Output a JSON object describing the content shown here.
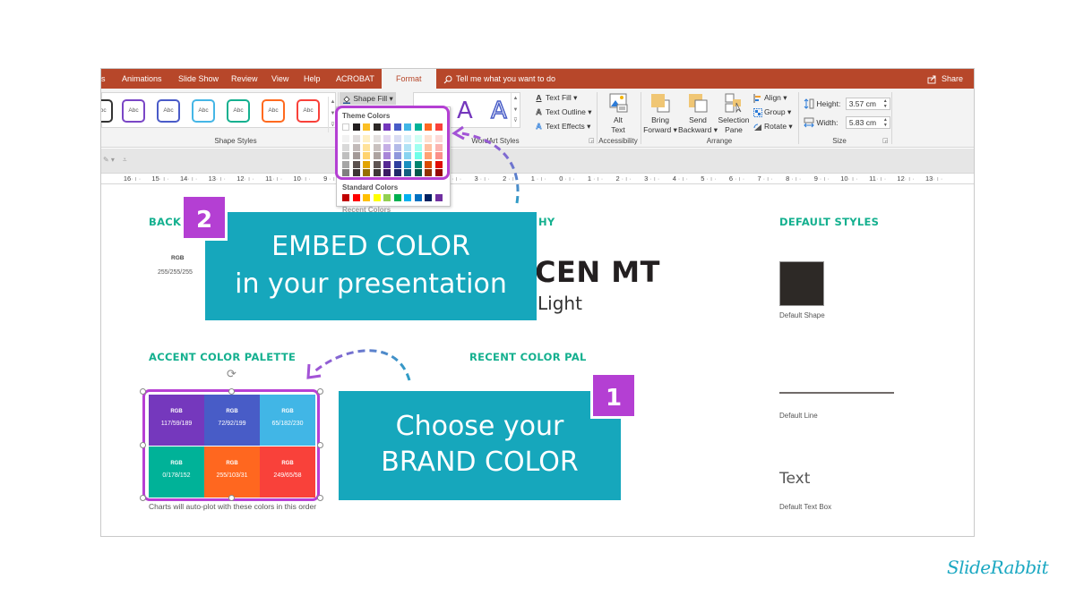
{
  "ribbon_tabs": [
    {
      "label": "s"
    },
    {
      "label": "Animations"
    },
    {
      "label": "Slide Show"
    },
    {
      "label": "Review"
    },
    {
      "label": "View"
    },
    {
      "label": "Help"
    },
    {
      "label": "ACROBAT"
    },
    {
      "label": "Format",
      "active": true
    }
  ],
  "tell_me": "Tell me what you want to do",
  "share_label": "Share",
  "shape_styles": {
    "items": [
      {
        "label": "Abc",
        "color": "#333333"
      },
      {
        "label": "Abc",
        "color": "#7a46c6"
      },
      {
        "label": "Abc",
        "color": "#4a5bc8"
      },
      {
        "label": "Abc",
        "color": "#45b6e6"
      },
      {
        "label": "Abc",
        "color": "#14b08f"
      },
      {
        "label": "Abc",
        "color": "#ff6a1f"
      },
      {
        "label": "Abc",
        "color": "#f9413a"
      }
    ],
    "group_label": "Shape Styles"
  },
  "shape_fill": {
    "label": "Shape Fill",
    "theme_colors_label": "Theme Colors",
    "standard_colors_label": "Standard Colors",
    "recent_colors_label": "Recent Colors",
    "theme_colors": [
      "#ffffff",
      "#231f20",
      "#fbbf24",
      "#2d2926",
      "#7538bd",
      "#485cc7",
      "#41b6e6",
      "#00b298",
      "#ff671f",
      "#f9413a"
    ],
    "tints": [
      [
        "#f2f2f2",
        "#e0dcdc",
        "#fff0c4",
        "#e4e0df",
        "#e3d6f2",
        "#d9dcf3",
        "#d8f0fa",
        "#cffff4",
        "#ffe0d0",
        "#fdd9d7"
      ],
      [
        "#d9d9d9",
        "#c2bab9",
        "#ffe29a",
        "#c9c1bf",
        "#c5aee5",
        "#b3bae8",
        "#b0e2f5",
        "#9ffff0",
        "#ffc1a2",
        "#fcb4b0"
      ],
      [
        "#bfbfbf",
        "#a39997",
        "#ffd36e",
        "#ada3a0",
        "#a885d8",
        "#8e97dc",
        "#88d3f0",
        "#6ffee8",
        "#ffa274",
        "#fb8f89"
      ],
      [
        "#a6a6a6",
        "#5a504e",
        "#e2a400",
        "#5e5452",
        "#562893",
        "#2f3f9f",
        "#198fbf",
        "#00856f",
        "#d94b00",
        "#e00c04"
      ],
      [
        "#808080",
        "#3c3534",
        "#967000",
        "#3f3836",
        "#3a1b62",
        "#1f2a6a",
        "#116080",
        "#00594a",
        "#913200",
        "#950803"
      ]
    ],
    "standard_colors": [
      "#c00000",
      "#ff0000",
      "#ffc000",
      "#ffff00",
      "#92d050",
      "#00b050",
      "#00b0f0",
      "#0070c0",
      "#002060",
      "#7030a0"
    ]
  },
  "wordart": {
    "group_label": "WordArt Styles",
    "a_glyph": "A"
  },
  "text_commands": [
    {
      "icon": "A",
      "label": "Text Fill ▾"
    },
    {
      "icon": "A",
      "label": "Text Outline ▾"
    },
    {
      "icon": "A",
      "label": "Text Effects ▾"
    }
  ],
  "accessibility": {
    "button_line1": "Alt",
    "button_line2": "Text",
    "group_label": "Accessibility"
  },
  "arrange": {
    "bring_forward": [
      "Bring",
      "Forward ▾"
    ],
    "send_backward": [
      "Send",
      "Backward ▾"
    ],
    "selection_pane": [
      "Selection",
      "Pane"
    ],
    "align": "Align ▾",
    "group": "Group ▾",
    "rotate": "Rotate ▾",
    "group_label": "Arrange"
  },
  "size": {
    "height_label": "Height:",
    "height_value": "3.57 cm",
    "width_label": "Width:",
    "width_value": "5.83 cm",
    "group_label": "Size"
  },
  "ruler_left": [
    "16",
    "15",
    "14",
    "13",
    "12",
    "11",
    "10",
    "9"
  ],
  "ruler_right": [
    "4",
    "3",
    "2",
    "1",
    "0",
    "1",
    "2",
    "3",
    "4",
    "5",
    "6",
    "7",
    "8",
    "9",
    "10",
    "11",
    "12",
    "13"
  ],
  "slide": {
    "background_head": "BACK",
    "background_rgb_label": "RGB",
    "background_rgb_value": "255/255/255",
    "typography_head": "HY",
    "font_name": "CEN MT",
    "font_light": "Light",
    "default_styles_head": "DEFAULT STYLES",
    "default_shape_label": "Default Shape",
    "default_line_label": "Default Line",
    "default_text_sample": "Text",
    "default_text_label": "Default Text Box",
    "accent_head": "ACCENT COLOR PALETTE",
    "recent_head": "RECENT COLOR PAL",
    "chart_note": "Charts will auto-plot with these colors in this order",
    "accent_swatches": [
      {
        "rgb_label": "RGB",
        "value": "117/59/189",
        "color": "#7538bd"
      },
      {
        "rgb_label": "RGB",
        "value": "72/92/199",
        "color": "#485cc7"
      },
      {
        "rgb_label": "RGB",
        "value": "65/182/230",
        "color": "#41b6e6"
      },
      {
        "rgb_label": "RGB",
        "value": "0/178/152",
        "color": "#00b298"
      },
      {
        "rgb_label": "RGB",
        "value": "255/103/31",
        "color": "#ff671f"
      },
      {
        "rgb_label": "RGB",
        "value": "249/65/58",
        "color": "#f9413a"
      }
    ]
  },
  "callouts": {
    "embed": {
      "badge": "2",
      "line1": "EMBED COLOR",
      "line2": "in your presentation"
    },
    "choose": {
      "badge": "1",
      "line1": "Choose your",
      "line2": "BRAND COLOR"
    }
  },
  "brand_logo": "SlideRabbit",
  "colors": {
    "ribbon": "#b7472a",
    "callout": "#16a7bc",
    "badge": "#b43fd3",
    "heading": "#14b08f"
  }
}
